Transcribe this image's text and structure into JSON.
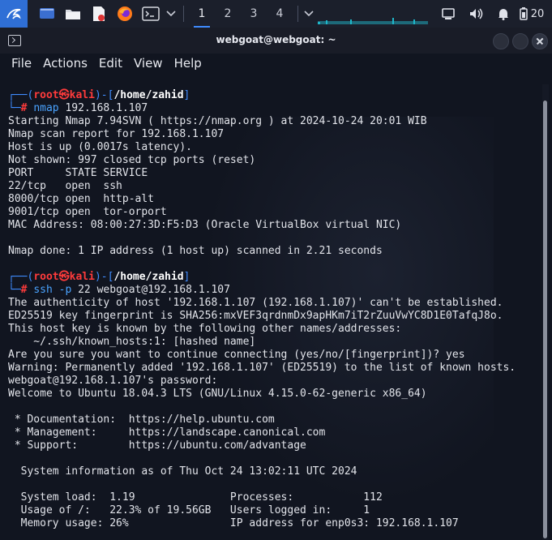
{
  "panel": {
    "workspaces": [
      "1",
      "2",
      "3",
      "4"
    ],
    "clock": "20"
  },
  "window": {
    "title": "webgoat@webgoat: ~",
    "menu": [
      "File",
      "Actions",
      "Edit",
      "View",
      "Help"
    ]
  },
  "terminal": {
    "prompt": {
      "user": "root",
      "at": "㉿",
      "host": "kali",
      "dir": "/home/zahid",
      "hash": "#"
    },
    "cmd1": {
      "name": "nmap",
      "args": " 192.168.1.107"
    },
    "nmap_out": [
      "Starting Nmap 7.94SVN ( https://nmap.org ) at 2024-10-24 20:01 WIB",
      "Nmap scan report for 192.168.1.107",
      "Host is up (0.0017s latency).",
      "Not shown: 997 closed tcp ports (reset)",
      "PORT     STATE SERVICE",
      "22/tcp   open  ssh",
      "8000/tcp open  http-alt",
      "9001/tcp open  tor-orport",
      "MAC Address: 08:00:27:3D:F5:D3 (Oracle VirtualBox virtual NIC)",
      "",
      "Nmap done: 1 IP address (1 host up) scanned in 2.21 seconds",
      ""
    ],
    "cmd2": {
      "name": "ssh",
      "flag": " -p",
      "args": " 22 webgoat@192.168.1.107"
    },
    "ssh_out": [
      "The authenticity of host '192.168.1.107 (192.168.1.107)' can't be established.",
      "ED25519 key fingerprint is SHA256:mxVEF3qrdnmDx9apHKm7iT2rZuuVwYC8D1E0TafqJ8o.",
      "This host key is known by the following other names/addresses:",
      "    ~/.ssh/known_hosts:1: [hashed name]",
      "Are you sure you want to continue connecting (yes/no/[fingerprint])? yes",
      "Warning: Permanently added '192.168.1.107' (ED25519) to the list of known hosts.",
      "webgoat@192.168.1.107's password:",
      "Welcome to Ubuntu 18.04.3 LTS (GNU/Linux 4.15.0-62-generic x86_64)",
      "",
      " * Documentation:  https://help.ubuntu.com",
      " * Management:     https://landscape.canonical.com",
      " * Support:        https://ubuntu.com/advantage",
      "",
      "  System information as of Thu Oct 24 13:02:11 UTC 2024",
      "",
      "  System load:  1.19               Processes:           112",
      "  Usage of /:   22.3% of 19.56GB   Users logged in:     1",
      "  Memory usage: 26%                IP address for enp0s3: 192.168.1.107"
    ]
  },
  "colors": {
    "prompt_blue": "#3f8cff",
    "prompt_red": "#ff3b3b",
    "panel_accent": "#2f6fd6"
  },
  "icons": [
    "kali-dragon-icon",
    "desktop-icon",
    "folder-icon",
    "text-editor-icon",
    "firefox-icon",
    "terminal-icon",
    "chevron-down-icon",
    "network-icon",
    "volume-icon",
    "notification-bell-icon",
    "battery-icon"
  ]
}
